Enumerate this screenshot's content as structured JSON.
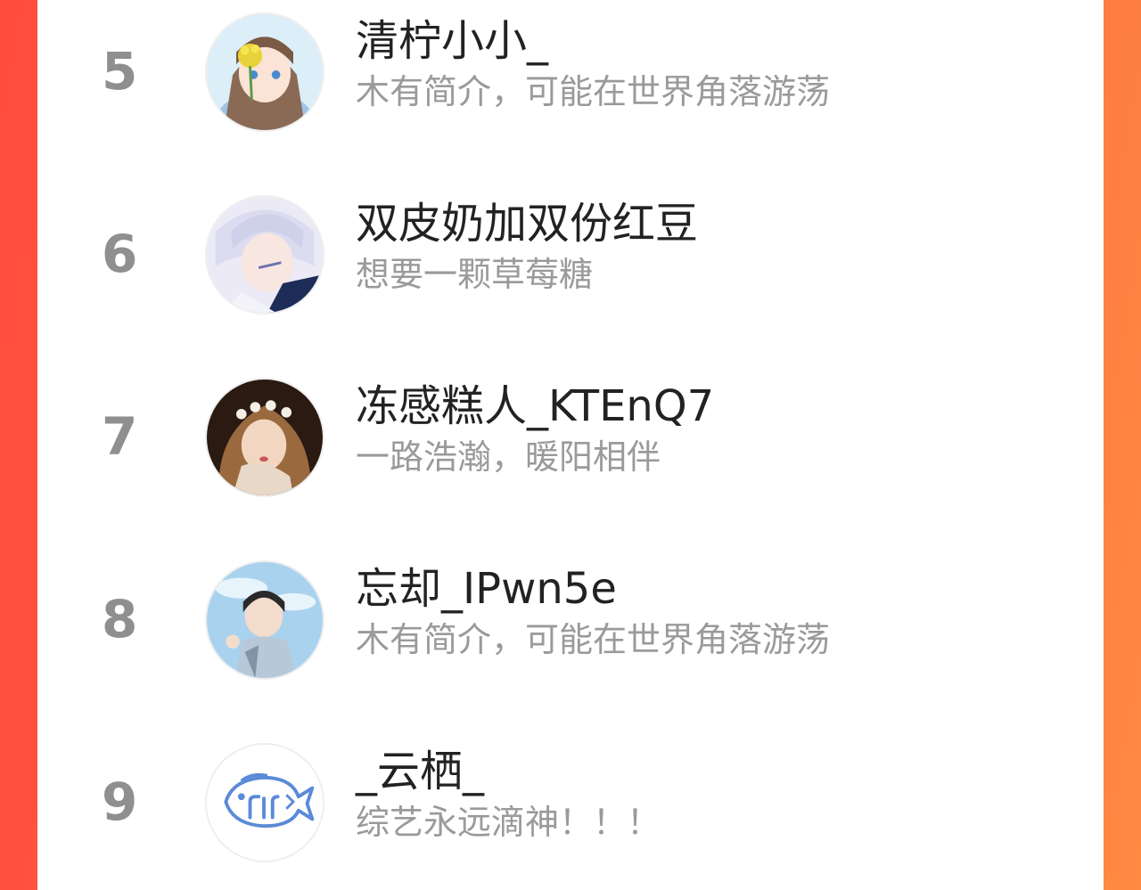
{
  "ranking": {
    "items": [
      {
        "rank": "5",
        "name": "清柠小小_",
        "bio": "木有简介，可能在世界角落游荡",
        "avatar_icon": "anime-girl-flower-avatar-icon"
      },
      {
        "rank": "6",
        "name": "双皮奶加双份红豆",
        "bio": "想要一颗草莓糖",
        "avatar_icon": "anime-boy-silver-hair-avatar-icon"
      },
      {
        "rank": "7",
        "name": "冻感糕人_KTEnQ7",
        "bio": "一路浩瀚，暖阳相伴",
        "avatar_icon": "painted-girl-flower-crown-avatar-icon"
      },
      {
        "rank": "8",
        "name": "忘却_IPwn5e",
        "bio": "木有简介，可能在世界角落游荡",
        "avatar_icon": "anime-boy-sky-avatar-icon"
      },
      {
        "rank": "9",
        "name": "_云栖_",
        "bio": "综艺永远滴神！！！",
        "avatar_icon": "blue-fish-logo-avatar-icon"
      }
    ]
  },
  "colors": {
    "background_left": "#ff4d3d",
    "background_right": "#ff8a42",
    "rank_text": "#8f8f8f",
    "name_text": "#222222",
    "bio_text": "#9a9a9a"
  }
}
